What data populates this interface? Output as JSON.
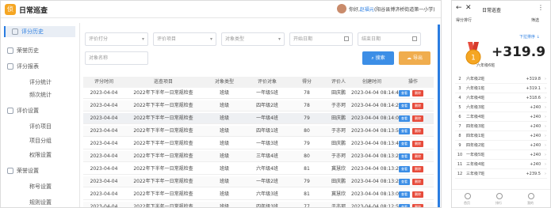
{
  "app": {
    "title": "日常巡查",
    "logo_glyph": "侦"
  },
  "header": {
    "greeting": "你好,",
    "user": "赵福元",
    "org": "(阳谷县博济桥街道第一小学)"
  },
  "sidebar": {
    "items": [
      {
        "label": "评分历史",
        "type": "group",
        "active": true,
        "icon": "history-icon"
      },
      {
        "label": "荣誉历史",
        "type": "group",
        "icon": "medal-icon"
      },
      {
        "label": "评分报表",
        "type": "group",
        "icon": "report-icon"
      },
      {
        "label": "评分统计",
        "type": "sub"
      },
      {
        "label": "频次统计",
        "type": "sub"
      },
      {
        "label": "评价设置",
        "type": "group",
        "icon": "settings-icon"
      },
      {
        "label": "评价项目",
        "type": "sub"
      },
      {
        "label": "项目分组",
        "type": "sub"
      },
      {
        "label": "权限设置",
        "type": "sub"
      },
      {
        "label": "荣誉设置",
        "type": "group",
        "icon": "honor-icon"
      },
      {
        "label": "称号设置",
        "type": "sub"
      },
      {
        "label": "规则设置",
        "type": "sub"
      }
    ]
  },
  "filters": {
    "score_type": "评价打分",
    "item": "评价项目",
    "object_type": "对象类型",
    "start_date": "开始日期",
    "end_date": "结束日期",
    "object_name": "对象名称",
    "search_label": "搜索",
    "export_label": "导出"
  },
  "table": {
    "headers": [
      "评分时间",
      "巡查项目",
      "对象类型",
      "评价对象",
      "得分",
      "评价人",
      "创建时间",
      "操作"
    ],
    "view_label": "查看",
    "delete_label": "删除",
    "rows": [
      [
        "2023-04-04",
        "2022年下半年一日常规检查",
        "班级",
        "一年级5班",
        "78",
        "田庆鹏",
        "2023-04-04 08:14:41"
      ],
      [
        "2023-04-04",
        "2022年下半年一日常规检查",
        "班级",
        "四年级2班",
        "78",
        "于亦珂",
        "2023-04-04 08:14:21"
      ],
      [
        "2023-04-04",
        "2022年下半年一日常规检查",
        "班级",
        "一年级4班",
        "79",
        "田庆鹏",
        "2023-04-04 08:14:02"
      ],
      [
        "2023-04-04",
        "2022年下半年一日常规检查",
        "班级",
        "四年级1班",
        "80",
        "于亦珂",
        "2023-04-04 08:13:59"
      ],
      [
        "2023-04-04",
        "2022年下半年一日常规检查",
        "班级",
        "一年级3班",
        "79",
        "田庆鹏",
        "2023-04-04 08:13:42"
      ],
      [
        "2023-04-04",
        "2022年下半年一日常规检查",
        "班级",
        "三年级4班",
        "80",
        "于亦珂",
        "2023-04-04 08:13:28"
      ],
      [
        "2023-04-04",
        "2022年下半年一日常规检查",
        "班级",
        "六年级4班",
        "81",
        "冀慧欣",
        "2023-04-04 08:13:25"
      ],
      [
        "2023-04-04",
        "2022年下半年一日常规检查",
        "班级",
        "一年级2班",
        "79",
        "田庆鹏",
        "2023-04-04 08:13:21"
      ],
      [
        "2023-04-04",
        "2022年下半年一日常规检查",
        "班级",
        "六年级3班",
        "81",
        "冀慧欣",
        "2023-04-04 08:13:07"
      ],
      [
        "2023-04-04",
        "2022年下半年一日常规检查",
        "班级",
        "四年级3班",
        "77",
        "于亦珂",
        "2023-04-04 08:12:56"
      ]
    ]
  },
  "mobile": {
    "title": "日常巡查",
    "subtitle": "得分排行",
    "filter_label": "筛选",
    "sort_label": "下拉排序 ↓",
    "top_score": "+319.9",
    "top_class": "六年级6班",
    "medal_number": "1",
    "ranking": [
      {
        "rank": "2",
        "name": "六年级2班",
        "value": "+319.8"
      },
      {
        "rank": "3",
        "name": "六年级1班",
        "value": "+319.1"
      },
      {
        "rank": "4",
        "name": "六年级4班",
        "value": "+318.6"
      },
      {
        "rank": "5",
        "name": "六年级3班",
        "value": "+240"
      },
      {
        "rank": "6",
        "name": "二年级4班",
        "value": "+240"
      },
      {
        "rank": "7",
        "name": "四年级3班",
        "value": "+240"
      },
      {
        "rank": "8",
        "name": "四年级1班",
        "value": "+240"
      },
      {
        "rank": "9",
        "name": "四年级2班",
        "value": "+240"
      },
      {
        "rank": "10",
        "name": "一年级5班",
        "value": "+240"
      },
      {
        "rank": "11",
        "name": "三年级4班",
        "value": "+240"
      },
      {
        "rank": "12",
        "name": "三年级7班",
        "value": "+239.5"
      }
    ],
    "nav": [
      "首页",
      "排行",
      "我的"
    ]
  },
  "colors": {
    "primary": "#3c8ee6",
    "export": "#f0ad4e",
    "danger": "#e74c3c",
    "medal": "#f5a623"
  }
}
